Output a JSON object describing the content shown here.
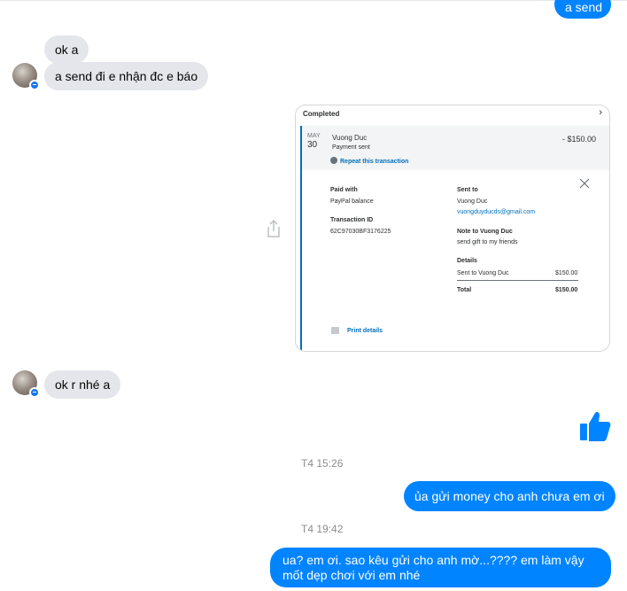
{
  "messages": {
    "top_out": "a send",
    "in_1": "ok a",
    "in_2": "a send đi e nhận đc e báo",
    "in_3": "ok r nhé a",
    "out_1": "ủa gửi money cho anh chưa em ơi",
    "out_2_line1": "ua? em ơi. sao kêu gửi cho anh mờ...???? em làm vậy",
    "out_2_line2": "mốt dẹp chơi với em nhé"
  },
  "timestamps": {
    "t1": "T4 15:26",
    "t2": "T4 19:42"
  },
  "paypal": {
    "status": "Completed",
    "month": "MAY",
    "day": "30",
    "payee": "Vuong Duc",
    "payment_type": "Payment sent",
    "repeat_label": "Repeat this transaction",
    "amount": "- $150.00",
    "paid_with_label": "Paid with",
    "paid_with_value": "PayPal balance",
    "transaction_id_label": "Transaction ID",
    "transaction_id": "62C97030BF3176225",
    "sent_to_label": "Sent to",
    "sent_to_name": "Vuong Duc",
    "sent_to_email": "vuongduyducds@gmail.com",
    "note_label": "Note to Vuong Duc",
    "note_text": "send gift to my friends",
    "details_label": "Details",
    "detail_row_label": "Sent to Vuong Duc",
    "detail_row_amount": "$150.00",
    "total_label": "Total",
    "total_amount": "$150.00",
    "print_label": "Print details"
  },
  "colors": {
    "outgoing_bubble": "#0084ff",
    "incoming_bubble": "#e4e6eb",
    "paypal_blue": "#0070ba",
    "like_blue": "#0084ff"
  },
  "icons": {
    "share": "share-icon",
    "like": "thumbs-up-icon",
    "close": "close-icon",
    "print": "printer-icon",
    "chevron": "chevron-right-icon"
  }
}
